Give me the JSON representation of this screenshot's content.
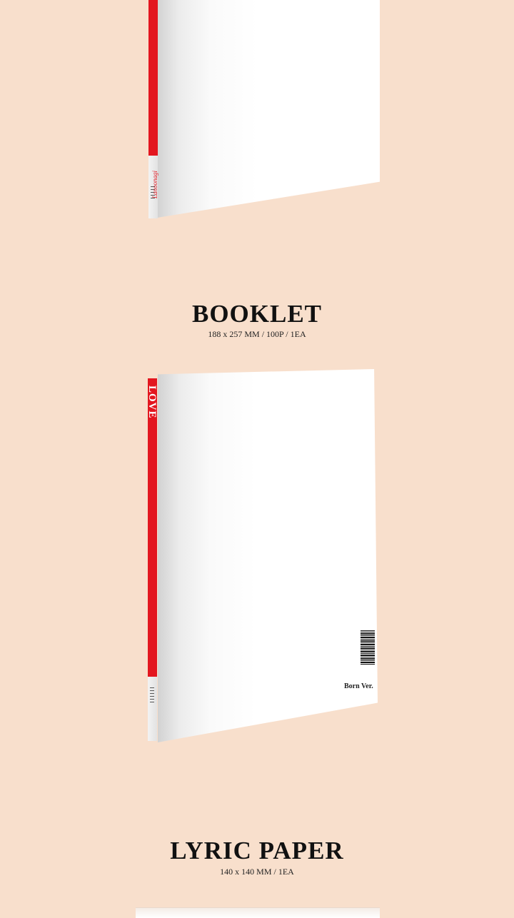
{
  "colors": {
    "background": "#f8dfcc",
    "spine_red": "#e3161f",
    "text": "#111111"
  },
  "top_book": {
    "spine_text": "Lanoonagi"
  },
  "booklet": {
    "title": "BOOKLET",
    "spec": "188 x 257 MM / 100P / 1EA",
    "spine_title": "LOVE",
    "version_label": "Born Ver."
  },
  "lyric_paper": {
    "title": "LYRIC PAPER",
    "spec": "140 x 140 MM / 1EA"
  }
}
